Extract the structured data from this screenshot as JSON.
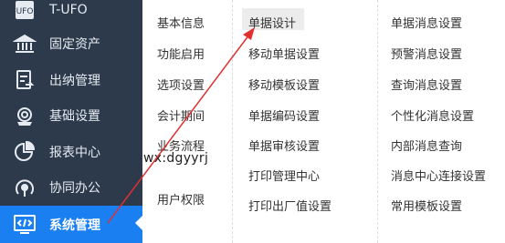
{
  "sidebar": {
    "items": [
      {
        "label": "T-UFO",
        "icon": "t-ufo-logo-icon"
      },
      {
        "label": "固定资产",
        "icon": "bank-icon"
      },
      {
        "label": "出纳管理",
        "icon": "cashier-document-icon"
      },
      {
        "label": "基础设置",
        "icon": "settings-gear-icon"
      },
      {
        "label": "报表中心",
        "icon": "pie-chart-icon"
      },
      {
        "label": "协同办公",
        "icon": "collaboration-icon"
      },
      {
        "label": "系统管理",
        "icon": "system-code-icon",
        "active": true
      }
    ]
  },
  "submenu": {
    "column1": [
      "基本信息",
      "功能启用",
      "选项设置",
      "会计期间",
      "业务流程",
      "用户权限"
    ],
    "column2": [
      "单据设计",
      "移动单据设置",
      "移动模板设置",
      "单据编码设置",
      "单据审核设置",
      "打印管理中心",
      "打印出厂值设置"
    ],
    "column3": [
      "单据消息设置",
      "预警消息设置",
      "查询消息设置",
      "个性化消息设置",
      "内部消息查询",
      "消息中心连接设置",
      "常用模板设置"
    ],
    "highlighted": "单据设计"
  },
  "watermark": "wx:dgyyrj",
  "colors": {
    "sidebar_bg": "#2c3a4b",
    "active_bg": "#1a7ff0",
    "arrow": "#e03030"
  }
}
